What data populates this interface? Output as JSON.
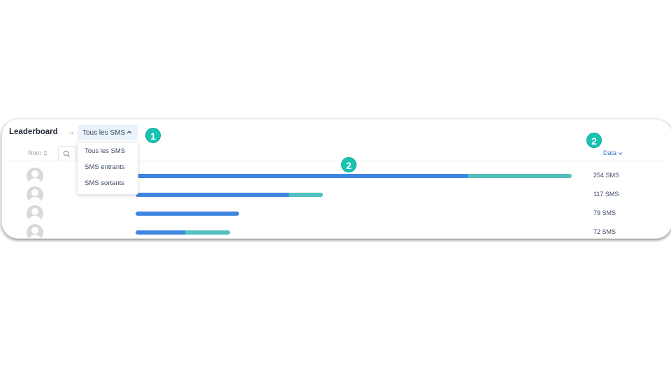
{
  "leaderboard": {
    "title": "Leaderboard",
    "arrow": "→",
    "filter": {
      "selected": "Tous les SMS",
      "options": [
        "Tous les SMS",
        "SMS entrants",
        "SMS sortants"
      ]
    },
    "columns": {
      "name": "Nom",
      "data": "Data"
    },
    "rows": [
      {
        "count": "254 SMS",
        "seg_a": 254,
        "seg_b": 79
      },
      {
        "count": "117 SMS",
        "seg_a": 117,
        "seg_b": 26
      },
      {
        "count": "79 SMS",
        "seg_a": 79,
        "seg_b": 0
      },
      {
        "count": "72 SMS",
        "seg_a": 38,
        "seg_b": 34
      }
    ],
    "colors": {
      "incoming": "#3f86e0",
      "outgoing": "#52c0be",
      "badge": "#17c3b2"
    }
  },
  "annotations": {
    "badge_1": "1",
    "badge_2a": "2",
    "badge_2b": "2"
  }
}
